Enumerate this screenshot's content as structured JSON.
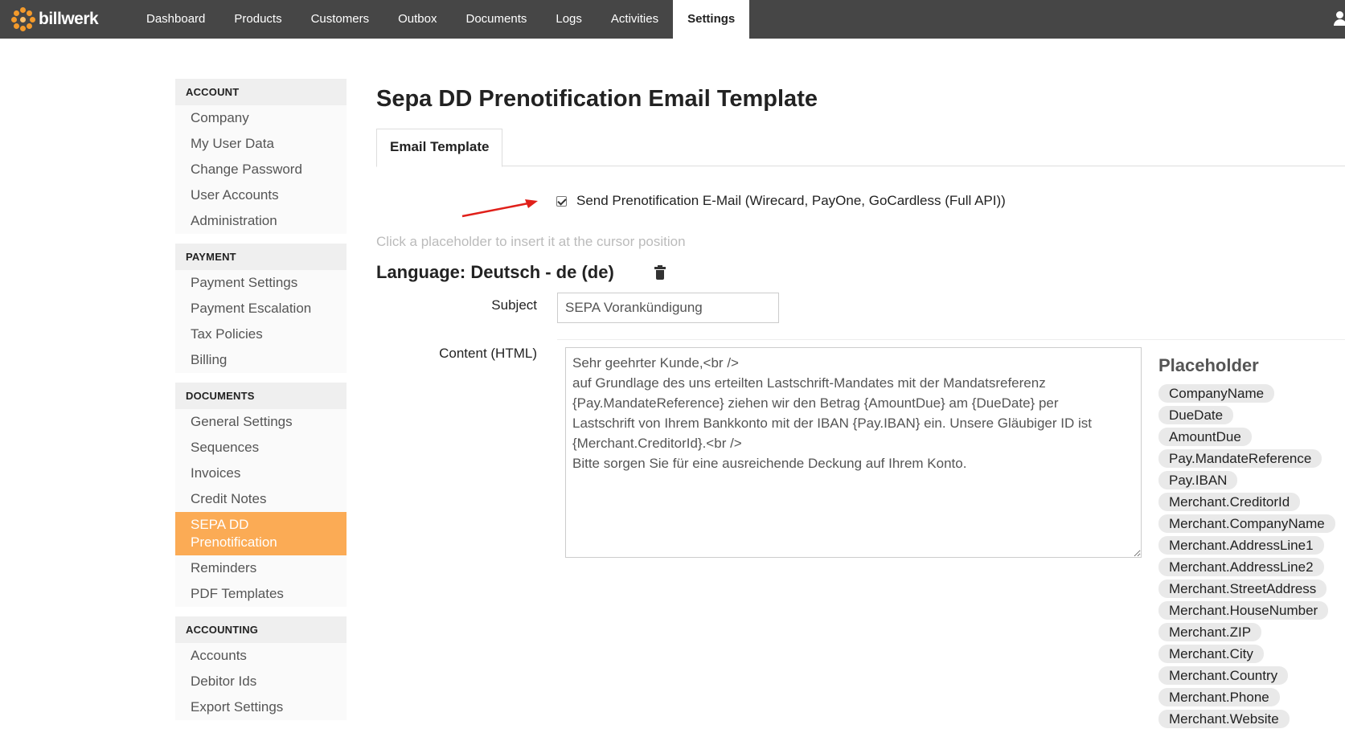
{
  "brand": {
    "name": "billwerk",
    "accent": "#f39a2b"
  },
  "nav": {
    "items": [
      {
        "label": "Dashboard",
        "active": false
      },
      {
        "label": "Products",
        "active": false
      },
      {
        "label": "Customers",
        "active": false
      },
      {
        "label": "Outbox",
        "active": false
      },
      {
        "label": "Documents",
        "active": false
      },
      {
        "label": "Logs",
        "active": false
      },
      {
        "label": "Activities",
        "active": false
      },
      {
        "label": "Settings",
        "active": true
      }
    ]
  },
  "sidebar": {
    "sections": [
      {
        "title": "ACCOUNT",
        "items": [
          "Company",
          "My User Data",
          "Change Password",
          "User Accounts",
          "Administration"
        ]
      },
      {
        "title": "PAYMENT",
        "items": [
          "Payment Settings",
          "Payment Escalation",
          "Tax Policies",
          "Billing"
        ]
      },
      {
        "title": "DOCUMENTS",
        "items": [
          "General Settings",
          "Sequences",
          "Invoices",
          "Credit Notes",
          "SEPA DD Prenotification",
          "Reminders",
          "PDF Templates"
        ]
      },
      {
        "title": "ACCOUNTING",
        "items": [
          "Accounts",
          "Debitor Ids",
          "Export Settings"
        ]
      }
    ],
    "active_item": "SEPA DD Prenotification",
    "active_color": "#fbab55"
  },
  "main": {
    "title": "Sepa DD Prenotification Email Template",
    "tab_label": "Email Template",
    "checkbox_label": "Send Prenotification E-Mail (Wirecard, PayOne, GoCardless (Full API))",
    "checkbox_checked": true,
    "hint": "Click a placeholder to insert it at the cursor position",
    "language_title": "Language: Deutsch - de (de)",
    "subject_label": "Subject",
    "subject_value": "SEPA Vorankündigung",
    "content_label": "Content (HTML)",
    "content_lines": [
      "Sehr geehrter Kunde,<br />",
      "auf Grundlage des uns erteilten Lastschrift-Mandates mit der Mandatsreferenz",
      "{Pay.MandateReference} ziehen wir den Betrag {AmountDue} am {DueDate} per",
      "Lastschrift von Ihrem Bankkonto mit der IBAN {Pay.IBAN} ein. Unsere Gläubiger ID ist",
      "{Merchant.CreditorId}.<br />",
      "Bitte sorgen Sie für eine ausreichende Deckung auf Ihrem Konto."
    ]
  },
  "placeholders": {
    "title": "Placeholder",
    "items": [
      "CompanyName",
      "DueDate",
      "AmountDue",
      "Pay.MandateReference",
      "Pay.IBAN",
      "Merchant.CreditorId",
      "Merchant.CompanyName",
      "Merchant.AddressLine1",
      "Merchant.AddressLine2",
      "Merchant.StreetAddress",
      "Merchant.HouseNumber",
      "Merchant.ZIP",
      "Merchant.City",
      "Merchant.Country",
      "Merchant.Phone",
      "Merchant.Website"
    ]
  }
}
